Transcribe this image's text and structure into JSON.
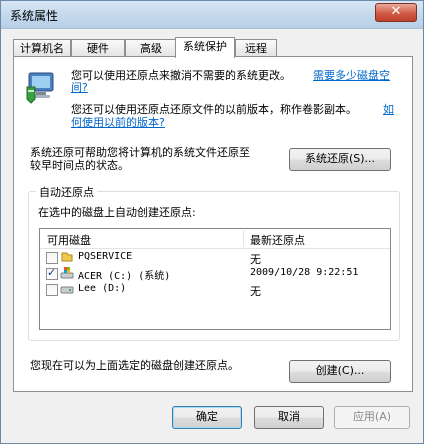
{
  "window": {
    "title": "系统属性",
    "close_glyph": "✕"
  },
  "tabs": [
    {
      "label": "计算机名",
      "active": false
    },
    {
      "label": "硬件",
      "active": false
    },
    {
      "label": "高级",
      "active": false
    },
    {
      "label": "系统保护",
      "active": true
    },
    {
      "label": "远程",
      "active": false
    }
  ],
  "protection": {
    "intro_text": "您可以使用还原点来撤消不需要的系统更改。",
    "intro_link_line1": "需要多少磁盘空",
    "intro_link_line2": "间?",
    "prev_text": "您还可以使用还原点还原文件的以前版本，称作卷影副本。",
    "prev_link_line1": "如",
    "prev_link_line2": "何使用以前的版本?",
    "restore_desc_line1": "系统还原可帮助您将计算机的系统文件还原至",
    "restore_desc_line2": "较早时间点的状态。",
    "restore_button": "系统还原(S)..."
  },
  "auto_restore": {
    "group_label": "自动还原点",
    "subtitle": "在选中的磁盘上自动创建还原点:",
    "columns": [
      "可用磁盘",
      "最新还原点"
    ],
    "rows": [
      {
        "checked": false,
        "icon": "folder-drive-icon",
        "name": "PQSERVICE",
        "latest": "无"
      },
      {
        "checked": true,
        "icon": "system-drive-icon",
        "name": "ACER (C:) (系统)",
        "latest": "2009/10/28 9:22:51"
      },
      {
        "checked": false,
        "icon": "drive-icon",
        "name": "Lee (D:)",
        "latest": "无"
      }
    ]
  },
  "create": {
    "text": "您现在可以为上面选定的磁盘创建还原点。",
    "button": "创建(C)..."
  },
  "footer": {
    "ok": "确定",
    "cancel": "取消",
    "apply": "应用(A)"
  }
}
